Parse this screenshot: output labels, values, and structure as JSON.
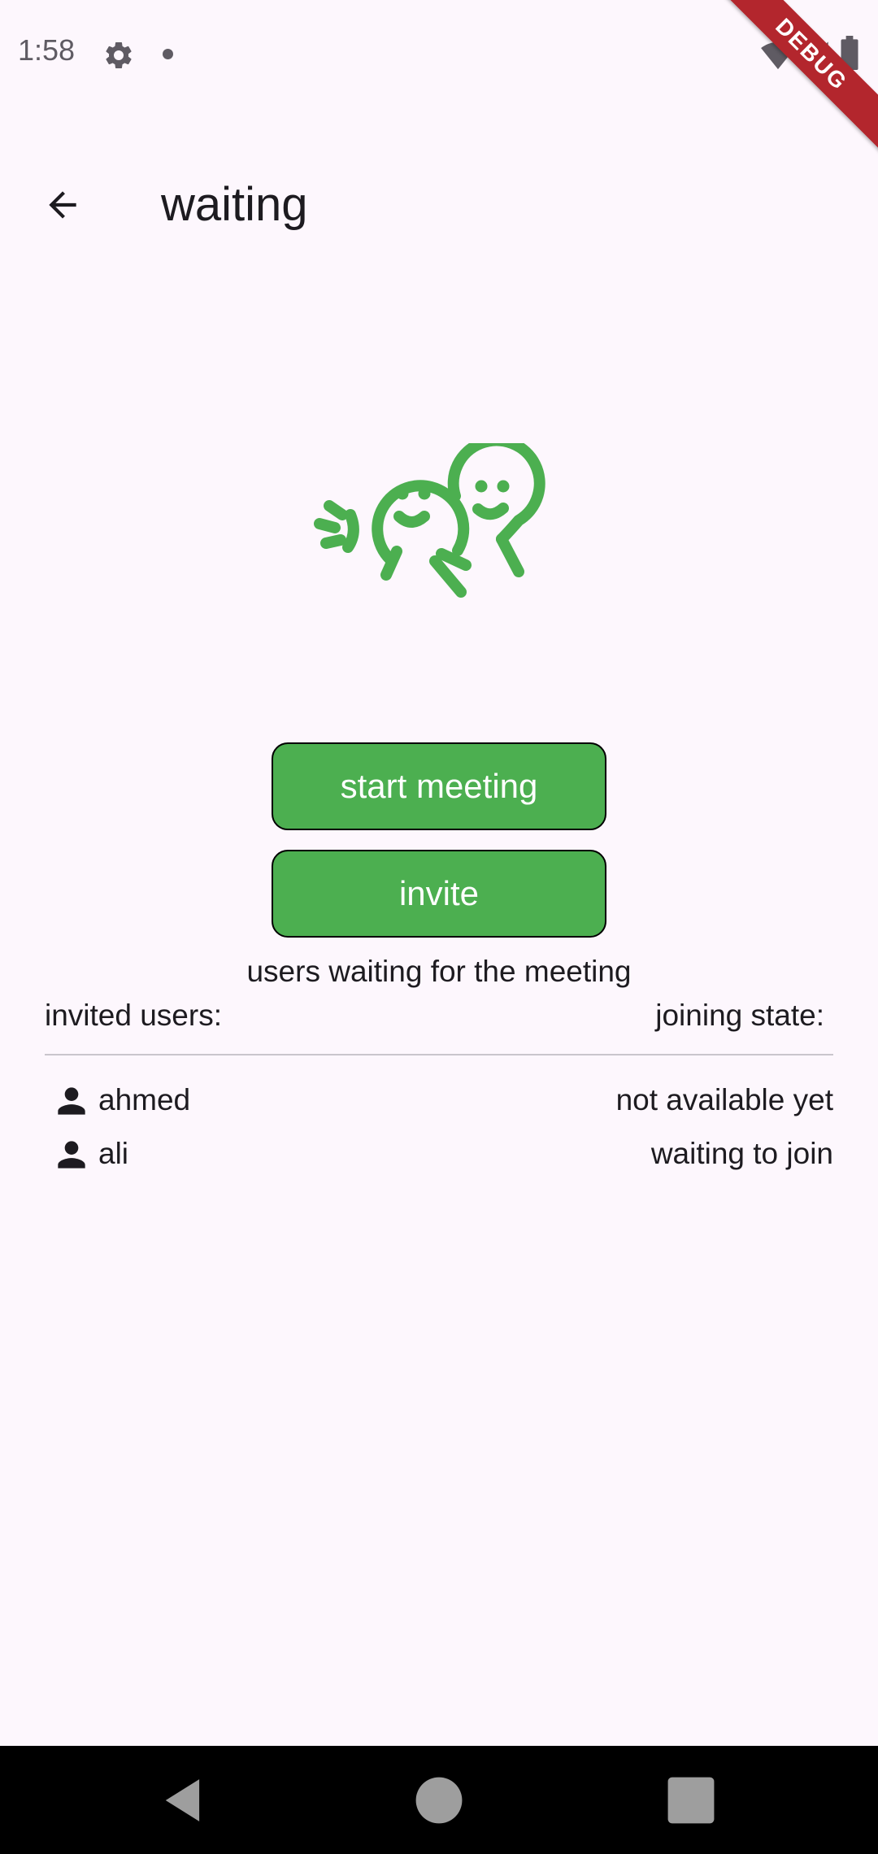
{
  "status_bar": {
    "time": "1:58",
    "icons": [
      "gear-icon",
      "notification-dot-icon",
      "wifi-icon",
      "signal-icon",
      "battery-icon"
    ]
  },
  "debug_banner": "DEBUG",
  "app_bar": {
    "back_icon": "arrow-back-icon",
    "title": "waiting"
  },
  "illustration": {
    "icon": "two-friends-icon",
    "color": "#4caf50"
  },
  "actions": {
    "start_label": "start meeting",
    "invite_label": "invite",
    "button_color": "#4caf50"
  },
  "waiting": {
    "heading": "users waiting for the meeting",
    "col_invited": "invited users:",
    "col_state": "joining state:",
    "users": [
      {
        "icon": "person-icon",
        "name": "ahmed",
        "state": "not available yet"
      },
      {
        "icon": "person-icon",
        "name": "ali",
        "state": "waiting to join"
      }
    ]
  },
  "nav_bar": {
    "icons": [
      "nav-back-icon",
      "nav-home-icon",
      "nav-recents-icon"
    ]
  }
}
